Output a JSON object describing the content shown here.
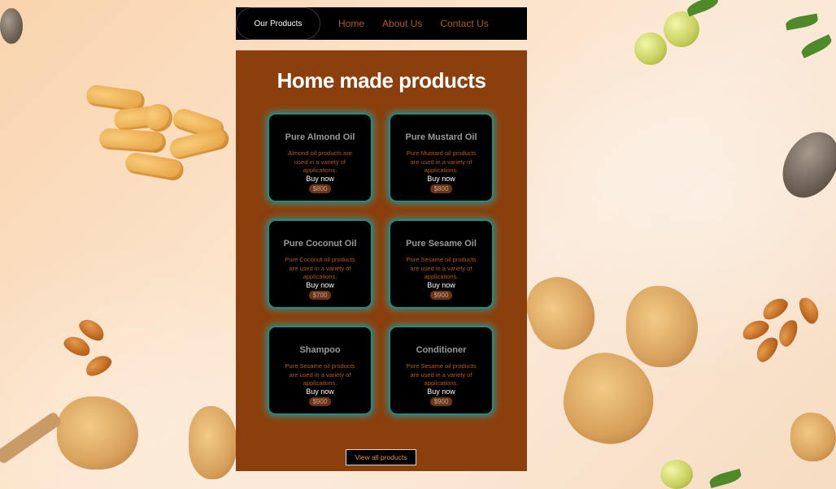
{
  "nav": {
    "active_label": "Our Products",
    "links": [
      "Home",
      "About Us",
      "Contact Us"
    ]
  },
  "main": {
    "title": "Home made products",
    "products": [
      {
        "name": "Pure Almond Oil",
        "description": "Almond oil products are used in a variety of applications.",
        "action": "Buy now",
        "price": "$800"
      },
      {
        "name": "Pure Mustard Oil",
        "description": "Pure Mustard oil products are used in a variety of applications.",
        "action": "Buy now",
        "price": "$800"
      },
      {
        "name": "Pure Coconut Oil",
        "description": "Pure Coconut oil products are used in a variety of applications.",
        "action": "Buy now",
        "price": "$700"
      },
      {
        "name": "Pure Sesame Oil",
        "description": "Pure Sesame oil products are used in a variety of applications.",
        "action": "Buy now",
        "price": "$900"
      },
      {
        "name": "Shampoo",
        "description": "Pure Sesame oil products are used in a variety of applications.",
        "action": "Buy now",
        "price": "$900"
      },
      {
        "name": "Conditioner",
        "description": "Pure Sesame oil products are used in a variety of applications.",
        "action": "Buy now",
        "price": "$900"
      }
    ],
    "view_all_label": "View all products"
  },
  "colors": {
    "panel_bg": "#8b3f0d",
    "card_border": "#1b8e8e",
    "accent_text": "#b3591a"
  }
}
